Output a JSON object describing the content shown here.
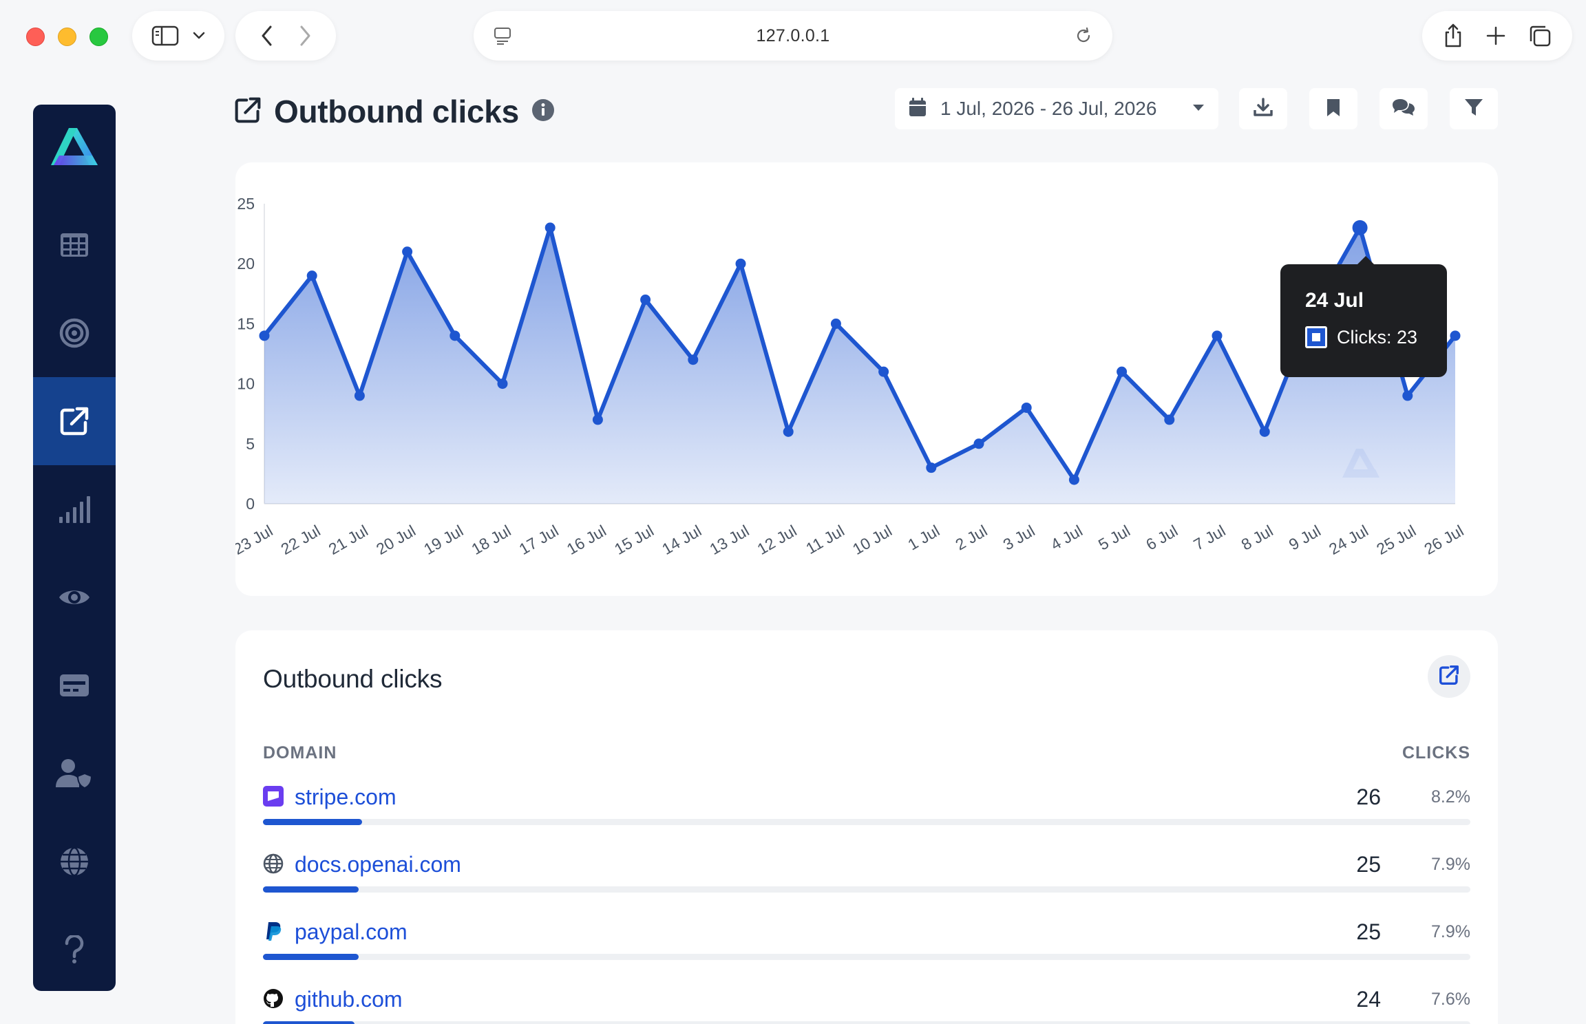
{
  "browser": {
    "url": "127.0.0.1"
  },
  "header": {
    "title": "Outbound clicks",
    "date_range": "1 Jul, 2026 - 26 Jul, 2026"
  },
  "sidebar": {
    "items": [
      {
        "name": "dashboard",
        "icon": "grid-icon",
        "active": false
      },
      {
        "name": "goals",
        "icon": "target-icon",
        "active": false
      },
      {
        "name": "outbound",
        "icon": "external-link-icon",
        "active": true
      },
      {
        "name": "stats",
        "icon": "signal-bars-icon",
        "active": false
      },
      {
        "name": "visitors",
        "icon": "eye-icon",
        "active": false
      },
      {
        "name": "billing",
        "icon": "card-icon",
        "active": false
      },
      {
        "name": "users",
        "icon": "user-shield-icon",
        "active": false
      },
      {
        "name": "sites",
        "icon": "globe-icon",
        "active": false
      },
      {
        "name": "help",
        "icon": "question-icon",
        "active": false
      }
    ]
  },
  "chart_data": {
    "type": "area",
    "x": [
      "23 Jul",
      "22 Jul",
      "21 Jul",
      "20 Jul",
      "19 Jul",
      "18 Jul",
      "17 Jul",
      "16 Jul",
      "15 Jul",
      "14 Jul",
      "13 Jul",
      "12 Jul",
      "11 Jul",
      "10 Jul",
      "1 Jul",
      "2 Jul",
      "3 Jul",
      "4 Jul",
      "5 Jul",
      "6 Jul",
      "7 Jul",
      "8 Jul",
      "9 Jul",
      "24 Jul",
      "25 Jul",
      "26 Jul"
    ],
    "series": [
      {
        "name": "Clicks",
        "values": [
          14,
          19,
          9,
          21,
          14,
          10,
          23,
          7,
          17,
          12,
          20,
          6,
          15,
          11,
          3,
          5,
          8,
          2,
          11,
          7,
          14,
          6,
          16,
          23,
          9,
          14
        ]
      }
    ],
    "ylim": [
      0,
      25
    ],
    "yticks": [
      0,
      5,
      10,
      15,
      20,
      25
    ],
    "color": "#1e56d0",
    "grid": false
  },
  "tooltip": {
    "date": "24 Jul",
    "label": "Clicks: 23"
  },
  "table": {
    "title": "Outbound clicks",
    "col_domain": "DOMAIN",
    "col_clicks": "CLICKS",
    "rows": [
      {
        "domain": "stripe.com",
        "clicks": "26",
        "pct": "8.2%",
        "share": 0.082,
        "icon": "stripe-icon"
      },
      {
        "domain": "docs.openai.com",
        "clicks": "25",
        "pct": "7.9%",
        "share": 0.079,
        "icon": "globe-icon"
      },
      {
        "domain": "paypal.com",
        "clicks": "25",
        "pct": "7.9%",
        "share": 0.079,
        "icon": "paypal-icon"
      },
      {
        "domain": "github.com",
        "clicks": "24",
        "pct": "7.6%",
        "share": 0.076,
        "icon": "github-icon"
      }
    ]
  }
}
